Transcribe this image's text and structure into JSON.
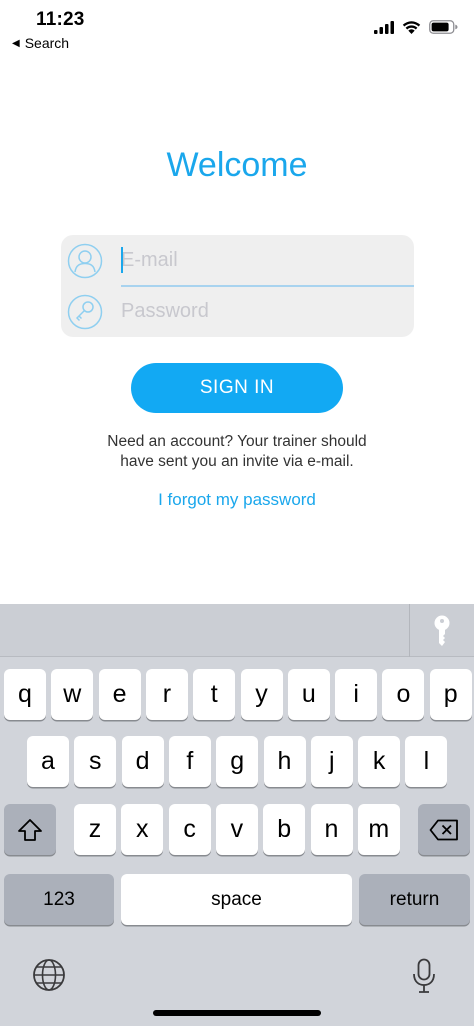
{
  "status_bar": {
    "time": "11:23",
    "back_label": "Search",
    "icons": [
      "signal-icon",
      "wifi-icon",
      "battery-icon"
    ]
  },
  "screen": {
    "title": "Welcome",
    "email": {
      "placeholder": "E-mail",
      "value": ""
    },
    "password": {
      "placeholder": "Password",
      "value": ""
    },
    "sign_in_label": "SIGN IN",
    "info_line1": "Need an account? Your trainer should",
    "info_line2": "have sent you an invite via e-mail.",
    "forgot_label": "I forgot my password"
  },
  "keyboard": {
    "row1": [
      "q",
      "w",
      "e",
      "r",
      "t",
      "y",
      "u",
      "i",
      "o",
      "p"
    ],
    "row2": [
      "a",
      "s",
      "d",
      "f",
      "g",
      "h",
      "j",
      "k",
      "l"
    ],
    "row3": [
      "z",
      "x",
      "c",
      "v",
      "b",
      "n",
      "m"
    ],
    "numbers_label": "123",
    "space_label": "space",
    "return_label": "return",
    "accessory_icon": "key-icon"
  },
  "colors": {
    "accent": "#1aa7ec",
    "button": "#12a9f3",
    "card": "#efefef",
    "keyboard_bg": "#d1d4da"
  }
}
